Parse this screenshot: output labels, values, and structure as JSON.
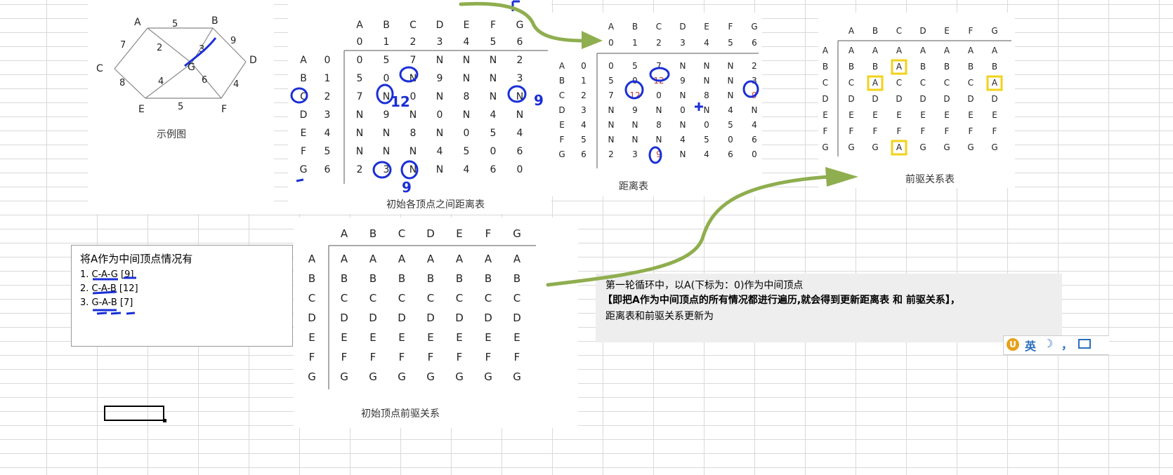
{
  "graph": {
    "caption": "示例图",
    "nodes": {
      "A": "A",
      "B": "B",
      "C": "C",
      "D": "D",
      "E": "E",
      "F": "F",
      "G": "G"
    },
    "weights": {
      "ab": "5",
      "ac": "7",
      "ag": "2",
      "bg": "3",
      "bd": "9",
      "ce": "8",
      "eg": "4",
      "gf": "6",
      "ef": "5",
      "df": "4"
    }
  },
  "cols": [
    "A",
    "B",
    "C",
    "D",
    "E",
    "F",
    "G"
  ],
  "idx": [
    "0",
    "1",
    "2",
    "3",
    "4",
    "5",
    "6"
  ],
  "init_dist": {
    "caption": "初始各顶点之间距离表",
    "rows": [
      [
        "0",
        "5",
        "7",
        "N",
        "N",
        "N",
        "2"
      ],
      [
        "5",
        "0",
        "N",
        "9",
        "N",
        "N",
        "3"
      ],
      [
        "7",
        "N",
        "0",
        "N",
        "8",
        "N",
        "N"
      ],
      [
        "N",
        "9",
        "N",
        "0",
        "N",
        "4",
        "N"
      ],
      [
        "N",
        "N",
        "8",
        "N",
        "0",
        "5",
        "4"
      ],
      [
        "N",
        "N",
        "N",
        "4",
        "5",
        "0",
        "6"
      ],
      [
        "2",
        "3",
        "N",
        "N",
        "4",
        "6",
        "0"
      ]
    ],
    "hand": {
      "c12": "12",
      "c9": "9",
      "g": "9"
    }
  },
  "new_dist": {
    "caption": "距离表",
    "rows": [
      [
        "0",
        "5",
        "7",
        "N",
        "N",
        "N",
        "2"
      ],
      [
        "5",
        "0",
        "12",
        "9",
        "N",
        "N",
        "3"
      ],
      [
        "7",
        "12",
        "0",
        "N",
        "8",
        "N",
        "9"
      ],
      [
        "N",
        "9",
        "N",
        "0",
        "N",
        "4",
        "N"
      ],
      [
        "N",
        "N",
        "8",
        "N",
        "0",
        "5",
        "4"
      ],
      [
        "N",
        "N",
        "N",
        "4",
        "5",
        "0",
        "6"
      ],
      [
        "2",
        "3",
        "9",
        "N",
        "4",
        "6",
        "0"
      ]
    ]
  },
  "new_pred": {
    "caption": "前驱关系表",
    "rows": [
      [
        "A",
        "A",
        "A",
        "A",
        "A",
        "A",
        "A"
      ],
      [
        "B",
        "B",
        "A",
        "B",
        "B",
        "B",
        "B"
      ],
      [
        "C",
        "A",
        "C",
        "C",
        "C",
        "C",
        "A"
      ],
      [
        "D",
        "D",
        "D",
        "D",
        "D",
        "D",
        "D"
      ],
      [
        "E",
        "E",
        "E",
        "E",
        "E",
        "E",
        "E"
      ],
      [
        "F",
        "F",
        "F",
        "F",
        "F",
        "F",
        "F"
      ],
      [
        "G",
        "G",
        "A",
        "G",
        "G",
        "G",
        "G"
      ]
    ]
  },
  "init_pred": {
    "caption": "初始顶点前驱关系",
    "rows": [
      [
        "A",
        "A",
        "A",
        "A",
        "A",
        "A",
        "A"
      ],
      [
        "B",
        "B",
        "B",
        "B",
        "B",
        "B",
        "B"
      ],
      [
        "C",
        "C",
        "C",
        "C",
        "C",
        "C",
        "C"
      ],
      [
        "D",
        "D",
        "D",
        "D",
        "D",
        "D",
        "D"
      ],
      [
        "E",
        "E",
        "E",
        "E",
        "E",
        "E",
        "E"
      ],
      [
        "F",
        "F",
        "F",
        "F",
        "F",
        "F",
        "F"
      ],
      [
        "G",
        "G",
        "G",
        "G",
        "G",
        "G",
        "G"
      ]
    ]
  },
  "cases": {
    "title": "将A作为中间顶点情况有",
    "items": [
      "1. C-A-G [9]",
      "2. C-A-B [12]",
      "3. G-A-B [7]"
    ]
  },
  "explain": {
    "line1": "第一轮循环中，以A(下标为：0)作为中间顶点",
    "line2": "【即把A作为中间顶点的所有情况都进行遍历,就会得到更新距离表 和 前驱关系】，",
    "line3": "距离表和前驱关系更新为"
  },
  "ime": {
    "label": "英",
    "extra": "，"
  },
  "colors": {
    "annotation": "#1a2fd6",
    "arrow": "#8fae4f",
    "highlight": "#f2d21b",
    "changed": "#c0392b"
  }
}
